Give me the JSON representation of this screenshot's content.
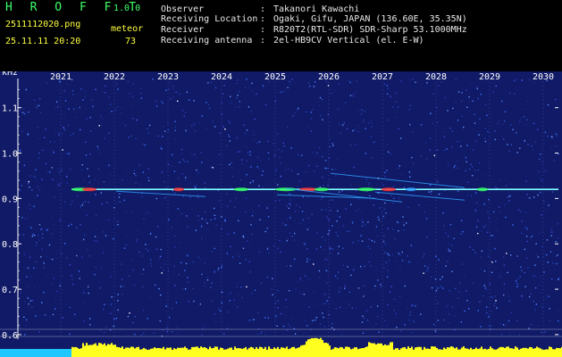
{
  "header": {
    "app_title": "H R O F F T",
    "app_version": "1.0.0",
    "file_name": "2511112020.png",
    "datetime": "25.11.11 20:20",
    "mode": "meteor",
    "count": "73"
  },
  "station": {
    "rows": [
      {
        "label": "Observer",
        "value": "Takanori Kawachi"
      },
      {
        "label": "Receiving Location",
        "value": "Ogaki, Gifu, JAPAN (136.60E, 35.35N)"
      },
      {
        "label": "Receiver",
        "value": "R820T2(RTL-SDR) SDR-Sharp 53.1000MHz"
      },
      {
        "label": "Receiving antenna",
        "value": "2el-HB9CV Vertical (el. E-W)"
      }
    ],
    "separator": ":"
  },
  "spectrogram": {
    "unit_label": "kHz",
    "x_ticks": [
      "2021",
      "2022",
      "2023",
      "2024",
      "2025",
      "2026",
      "2027",
      "2028",
      "2029",
      "2030"
    ],
    "y_ticks": [
      "1.1",
      "1.0",
      "0.9",
      "0.8",
      "0.7",
      "0.6"
    ],
    "y_range": [
      0.59,
      1.18
    ],
    "carrier_khz": 0.92,
    "colors": {
      "background": "#101a66",
      "grid": "#8a8aff",
      "carrier": "#7fffff",
      "meteor_hot": "#ff3030",
      "meteor_mid": "#30ff60",
      "meteor_cool": "#30a0ff",
      "noise_bar": "#ffff20",
      "floor_strip": "#1ec8ff",
      "labels": "#ffffff",
      "ticks": "#ffffff"
    }
  }
}
